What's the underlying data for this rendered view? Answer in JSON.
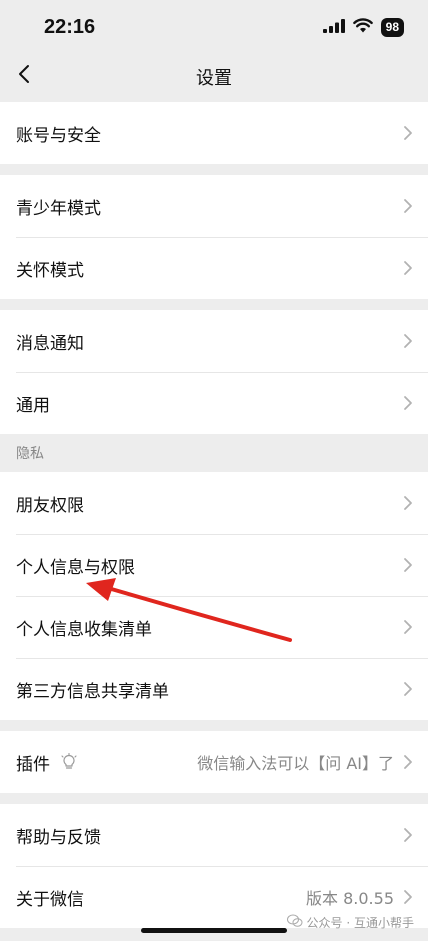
{
  "status": {
    "time": "22:16",
    "battery": "98"
  },
  "nav": {
    "title": "设置"
  },
  "groups": {
    "account": {
      "security": "账号与安全"
    },
    "modes": {
      "youth": "青少年模式",
      "care": "关怀模式"
    },
    "general": {
      "notifications": "消息通知",
      "general": "通用"
    },
    "privacy": {
      "header": "隐私",
      "friend_permissions": "朋友权限",
      "personal_info": "个人信息与权限",
      "info_collection": "个人信息收集清单",
      "third_party": "第三方信息共享清单"
    },
    "plugins": {
      "label": "插件",
      "value": "微信输入法可以【问 AI】了"
    },
    "about": {
      "help": "帮助与反馈",
      "about_wechat": "关于微信",
      "version": "版本 8.0.55"
    }
  },
  "watermark": "公众号 · 互通小帮手",
  "colors": {
    "background": "#ededed",
    "card": "#ffffff",
    "arrow": "#e0261e"
  }
}
